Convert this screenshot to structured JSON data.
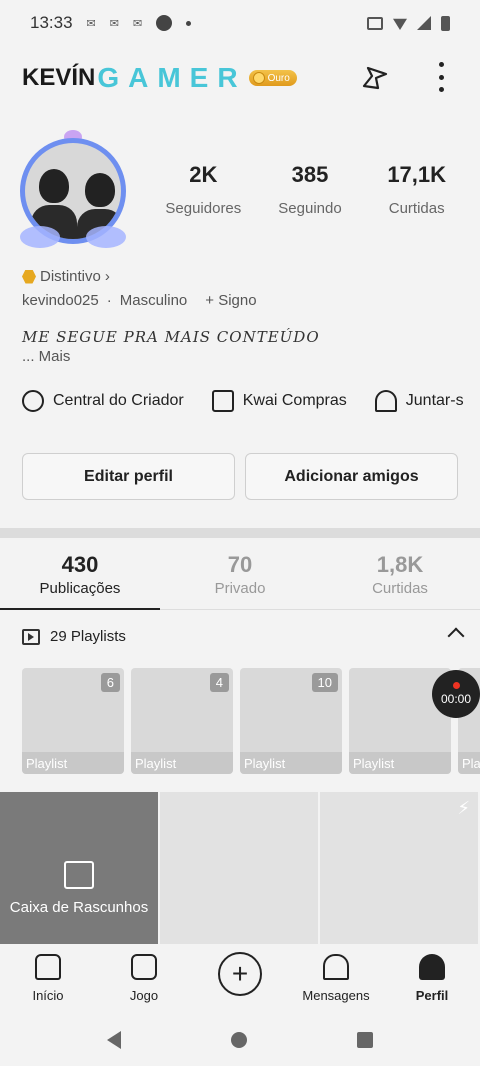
{
  "status": {
    "time": "13:33"
  },
  "header": {
    "name_prefix": "KEVÍN",
    "name_suffix": "GAMER",
    "badge": "Ouro"
  },
  "stats": [
    {
      "value": "2K",
      "label": "Seguidores"
    },
    {
      "value": "385",
      "label": "Seguindo"
    },
    {
      "value": "17,1K",
      "label": "Curtidas"
    }
  ],
  "profile": {
    "distintivo": "Distintivo",
    "username": "kevindo025",
    "gender": "Masculino",
    "sign": "+ Signo",
    "bio": "ME SEGUE PRA MAIS CONTEÚDO",
    "more": "... Mais"
  },
  "links": [
    {
      "label": "Central do Criador",
      "icon": "lightning-circle-icon"
    },
    {
      "label": "Kwai Compras",
      "icon": "shopping-bag-icon"
    },
    {
      "label": "Juntar-s",
      "icon": "tent-icon"
    }
  ],
  "buttons": {
    "edit": "Editar perfil",
    "add": "Adicionar amigos"
  },
  "tabs": [
    {
      "value": "430",
      "label": "Publicações"
    },
    {
      "value": "70",
      "label": "Privado"
    },
    {
      "value": "1,8K",
      "label": "Curtidas"
    }
  ],
  "playlists": {
    "header": "29 Playlists",
    "items": [
      {
        "count": "6",
        "label": "Playlist"
      },
      {
        "count": "4",
        "label": "Playlist"
      },
      {
        "count": "10",
        "label": "Playlist"
      },
      {
        "count": "",
        "label": "Playlist"
      },
      {
        "count": "",
        "label": "Pla"
      }
    ]
  },
  "recording": "00:00",
  "drafts": "Caixa de Rascunhos",
  "nav": {
    "home": "Início",
    "game": "Jogo",
    "messages": "Mensagens",
    "profile": "Perfil"
  }
}
